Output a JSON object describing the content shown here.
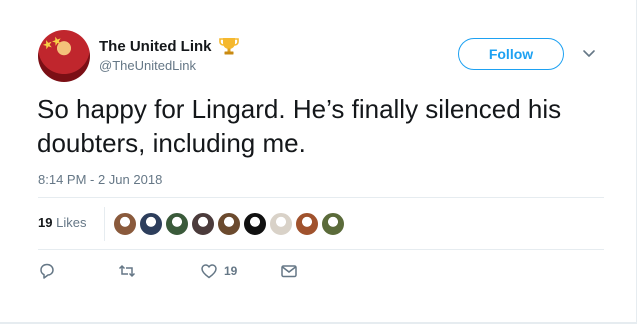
{
  "header": {
    "display_name": "The United Link",
    "handle": "@TheUnitedLink",
    "follow_label": "Follow",
    "badge_icon": "trophy-icon"
  },
  "tweet": {
    "text": "So happy for Lingard. He’s finally silenced his doubters, including me.",
    "timestamp": "8:14 PM - 2 Jun 2018"
  },
  "stats": {
    "likes_count": "19",
    "likes_label": "Likes",
    "likers": [
      {
        "name": "liker-avatar-1",
        "color": "#8a5a3c"
      },
      {
        "name": "liker-avatar-2",
        "color": "#2d3e5c"
      },
      {
        "name": "liker-avatar-3",
        "color": "#3a5a3a"
      },
      {
        "name": "liker-avatar-4",
        "color": "#4b3b3b"
      },
      {
        "name": "liker-avatar-5",
        "color": "#6b4a2e"
      },
      {
        "name": "liker-avatar-6",
        "color": "#111111"
      },
      {
        "name": "liker-avatar-7",
        "color": "#d9d2c8"
      },
      {
        "name": "liker-avatar-8",
        "color": "#a0522d"
      },
      {
        "name": "liker-avatar-9",
        "color": "#5b6b3a"
      }
    ]
  },
  "actions": {
    "reply_icon": "reply-icon",
    "retweet_icon": "retweet-icon",
    "like_icon": "heart-icon",
    "like_count": "19",
    "dm_icon": "envelope-icon"
  },
  "colors": {
    "accent": "#1da1f2",
    "text": "#14171a",
    "muted": "#657786",
    "border": "#e6ecf0"
  }
}
